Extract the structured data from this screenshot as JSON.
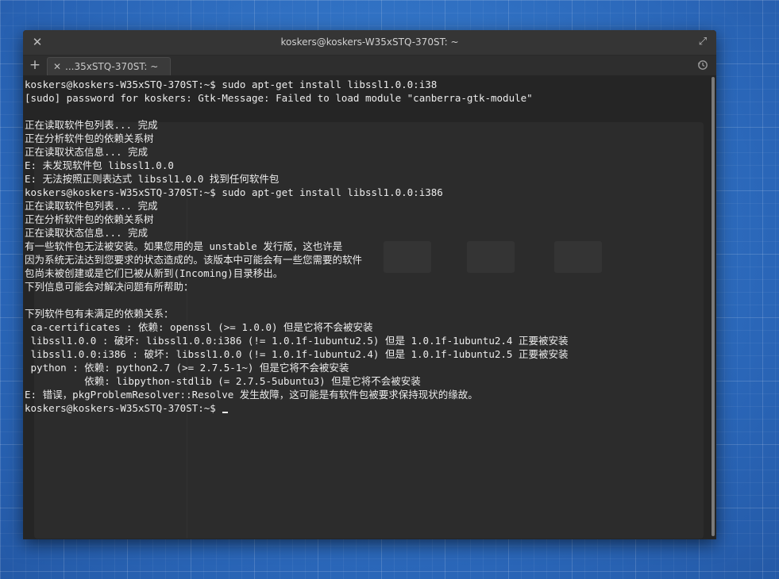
{
  "window": {
    "title": "koskers@koskers-W35xSTQ-370ST: ~",
    "close_icon": "close-icon",
    "maximize_icon": "maximize-icon"
  },
  "tabbar": {
    "new_tab_icon": "plus-icon",
    "tabs": [
      {
        "label": "...35xSTQ-370ST: ~"
      }
    ],
    "history_icon": "history-icon"
  },
  "terminal": {
    "lines": [
      "koskers@koskers-W35xSTQ-370ST:~$ sudo apt-get install libssl1.0.0:i38",
      "[sudo] password for koskers: Gtk-Message: Failed to load module \"canberra-gtk-module\"",
      "",
      "正在读取软件包列表... 完成",
      "正在分析软件包的依赖关系树",
      "正在读取状态信息... 完成",
      "E: 未发现软件包 libssl1.0.0",
      "E: 无法按照正则表达式 libssl1.0.0 找到任何软件包",
      "koskers@koskers-W35xSTQ-370ST:~$ sudo apt-get install libssl1.0.0:i386",
      "正在读取软件包列表... 完成",
      "正在分析软件包的依赖关系树",
      "正在读取状态信息... 完成",
      "有一些软件包无法被安装。如果您用的是 unstable 发行版，这也许是",
      "因为系统无法达到您要求的状态造成的。该版本中可能会有一些您需要的软件",
      "包尚未被创建或是它们已被从新到(Incoming)目录移出。",
      "下列信息可能会对解决问题有所帮助：",
      "",
      "下列软件包有未满足的依赖关系：",
      " ca-certificates : 依赖: openssl (>= 1.0.0) 但是它将不会被安装",
      " libssl1.0.0 : 破坏: libssl1.0.0:i386 (!= 1.0.1f-1ubuntu2.5) 但是 1.0.1f-1ubuntu2.4 正要被安装",
      " libssl1.0.0:i386 : 破坏: libssl1.0.0 (!= 1.0.1f-1ubuntu2.4) 但是 1.0.1f-1ubuntu2.5 正要被安装",
      " python : 依赖: python2.7 (>= 2.7.5-1~) 但是它将不会被安装",
      "          依赖: libpython-stdlib (= 2.7.5-5ubuntu3) 但是它将不会被安装",
      "E: 错误，pkgProblemResolver::Resolve 发生故障，这可能是有软件包被要求保持现状的缘故。"
    ],
    "prompt": "koskers@koskers-W35xSTQ-370ST:~$ "
  }
}
